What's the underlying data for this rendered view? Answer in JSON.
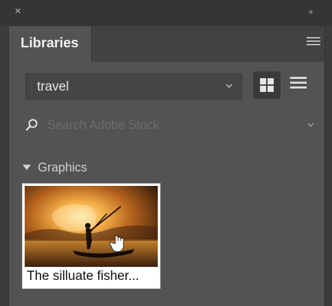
{
  "window": {
    "close_glyph": "×",
    "collapse_glyph": "‹‹"
  },
  "panel": {
    "tab_label": "Libraries",
    "menu_icon": "hamburger-menu-icon"
  },
  "library_select": {
    "value": "travel",
    "chevron_icon": "chevron-down-icon"
  },
  "view_toggle": {
    "grid_icon": "grid-view-icon",
    "list_icon": "list-view-icon",
    "active": "grid"
  },
  "search": {
    "placeholder": "Search Adobe Stock",
    "icon": "search-icon",
    "chevron_icon": "chevron-down-icon"
  },
  "group": {
    "title": "Graphics",
    "items": [
      {
        "caption": "The silluate fisher...",
        "thumbnail": "sunset-fisherman-image"
      }
    ]
  },
  "colors": {
    "panel_bg": "#535353",
    "chrome_bg": "#353535",
    "card_bg": "#ffffff"
  }
}
